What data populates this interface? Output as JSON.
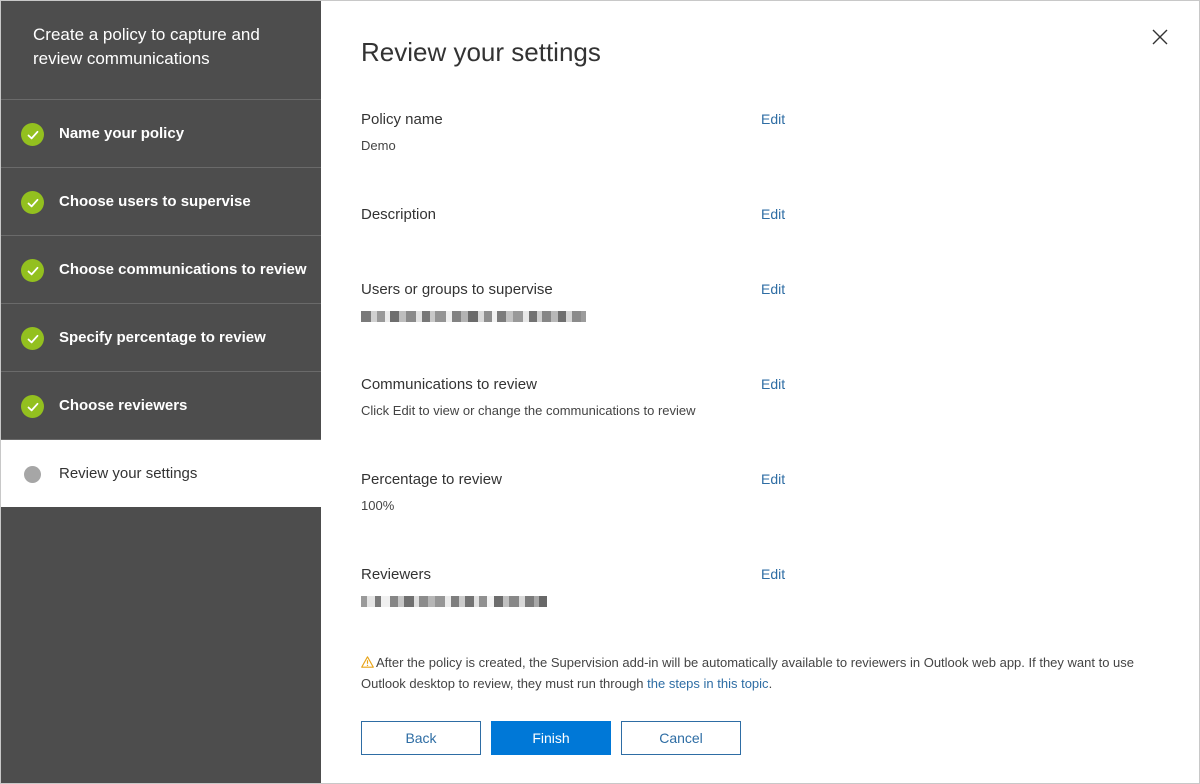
{
  "sidebar": {
    "title": "Create a policy to capture and review communications",
    "steps": [
      {
        "label": "Name your policy",
        "state": "complete"
      },
      {
        "label": "Choose users to supervise",
        "state": "complete"
      },
      {
        "label": "Choose communications to review",
        "state": "complete"
      },
      {
        "label": "Specify percentage to review",
        "state": "complete"
      },
      {
        "label": "Choose reviewers",
        "state": "complete"
      },
      {
        "label": "Review your settings",
        "state": "current"
      }
    ]
  },
  "main": {
    "title": "Review your settings",
    "edit_label": "Edit",
    "sections": {
      "policy_name": {
        "heading": "Policy name",
        "value": "Demo"
      },
      "description": {
        "heading": "Description",
        "value": ""
      },
      "users": {
        "heading": "Users or groups to supervise",
        "value_redacted": true
      },
      "communications": {
        "heading": "Communications to review",
        "value": "Click Edit to view or change the communications to review"
      },
      "percentage": {
        "heading": "Percentage to review",
        "value": "100%"
      },
      "reviewers": {
        "heading": "Reviewers",
        "value_redacted": true
      }
    },
    "note": {
      "text": "After the policy is created, the Supervision add-in will be automatically available to reviewers in Outlook web app. If they want to use Outlook desktop to review, they must run through ",
      "link": "the steps in this topic",
      "suffix": "."
    },
    "buttons": {
      "back": "Back",
      "finish": "Finish",
      "cancel": "Cancel"
    }
  },
  "icons": {
    "close": "close-icon",
    "check": "checkmark-icon",
    "warning": "warning-icon"
  },
  "colors": {
    "sidebar_bg": "#4d4d4d",
    "check_green": "#93c01f",
    "link_blue": "#2e6da4",
    "primary_button": "#0078d7",
    "warning": "#e8a317"
  }
}
